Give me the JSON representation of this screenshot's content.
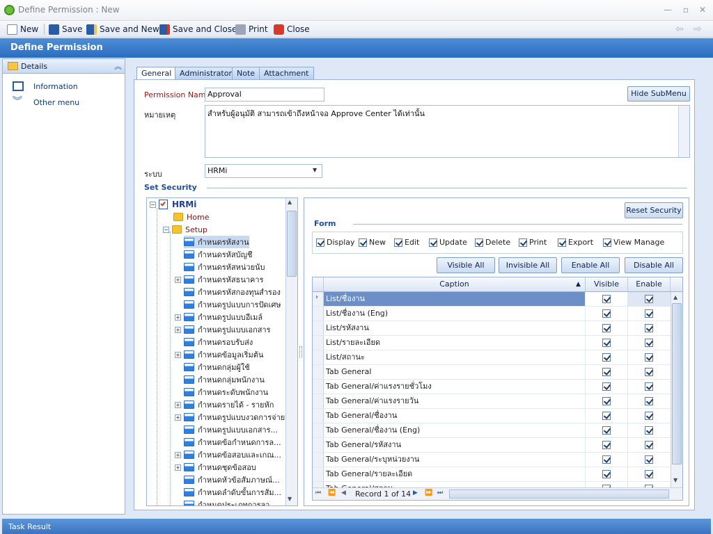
{
  "window": {
    "title": "Define Permission : New"
  },
  "toolbar": {
    "new": "New",
    "save": "Save",
    "save_and_new": "Save and New",
    "save_and_close": "Save and Close",
    "print": "Print",
    "close": "Close"
  },
  "header": {
    "title": "Define Permission"
  },
  "sidebar": {
    "details": "Details",
    "items": [
      {
        "label": "Information",
        "icon": "info-icon"
      },
      {
        "label": "Other menu",
        "icon": "double-chevron-down-icon"
      }
    ]
  },
  "tabs": [
    "General",
    "Administrator",
    "Note",
    "Attachment"
  ],
  "form": {
    "permission_name_label": "Permission Name",
    "permission_name_value": "Approval",
    "note_label": "หมายเหตุ",
    "note_value": "สำหรับผู้อนุมัติ  สามารถเข้าถึงหน้าจอ Approve Center ได้เท่านั้น",
    "system_label": "ระบบ",
    "system_value": "HRMi",
    "hide_submenu": "Hide SubMenu",
    "set_security": "Set Security"
  },
  "tree": {
    "root": "HRMi",
    "home": "Home",
    "setup": "Setup",
    "items": [
      {
        "label": "กำหนดรหัสงาน",
        "expand": false,
        "selected": true
      },
      {
        "label": "กำหนดรหัสบัญชี",
        "expand": false
      },
      {
        "label": "กำหนดรหัสหน่วยนับ",
        "expand": false
      },
      {
        "label": "กำหนดรหัสธนาคาร",
        "expand": true
      },
      {
        "label": "กำหนดรหัสกองทุนสำรอง",
        "expand": false
      },
      {
        "label": "กำหนดรูปแบบการปัดเศษ",
        "expand": false
      },
      {
        "label": "กำหนดรูปแบบอีเมล์",
        "expand": true
      },
      {
        "label": "กำหนดรูปแบบเอกสาร",
        "expand": true
      },
      {
        "label": "กำหนดรอบรับส่ง",
        "expand": false
      },
      {
        "label": "กำหนดข้อมูลเริ่มต้น",
        "expand": true
      },
      {
        "label": "กำหนดกลุ่มผู้ใช้",
        "expand": false
      },
      {
        "label": "กำหนดกลุ่มพนักงาน",
        "expand": false
      },
      {
        "label": "กำหนดระดับพนักงาน",
        "expand": false
      },
      {
        "label": "กำหนดรายได้ - รายหัก",
        "expand": true
      },
      {
        "label": "กำหนดรูปแบบงวดการจ่าย",
        "expand": true
      },
      {
        "label": "กำหนดรูปแบบเอกสาร...",
        "expand": false
      },
      {
        "label": "กำหนดข้อกำหนดการล...",
        "expand": false
      },
      {
        "label": "กำหนดข้อสอบและเกณ...",
        "expand": true
      },
      {
        "label": "กำหนดชุดข้อสอบ",
        "expand": true
      },
      {
        "label": "กำหนดหัวข้อสัมภาษณ์...",
        "expand": false
      },
      {
        "label": "กำหนดลำดับขั้นการสัม...",
        "expand": false
      },
      {
        "label": "กำหนดประเภทการลา",
        "expand": false
      }
    ]
  },
  "security": {
    "reset": "Reset Security",
    "form_label": "Form",
    "permissions": [
      "Display",
      "New",
      "Edit",
      "Update",
      "Delete",
      "Print",
      "Export",
      "View Manage"
    ],
    "visible_all": "Visible All",
    "invisible_all": "Invisible All",
    "enable_all": "Enable All",
    "disable_all": "Disable All"
  },
  "grid": {
    "headers": {
      "caption": "Caption",
      "visible": "Visible",
      "enable": "Enable"
    },
    "rows": [
      "List/ชื่องาน",
      "List/ชื่องาน (Eng)",
      "List/รหัสงาน",
      "List/รายละเอียด",
      "List/สถานะ",
      "Tab General",
      "Tab General/ค่าแรงรายชั่วโมง",
      "Tab General/ค่าแรงรายวัน",
      "Tab General/ชื่องาน",
      "Tab General/ชื่องาน (Eng)",
      "Tab General/รหัสงาน",
      "Tab General/ระบุหน่วยงาน",
      "Tab General/รายละเอียด",
      "Tab General/สถานะ"
    ],
    "record_text": "Record 1 of 14"
  },
  "statusbar": {
    "text": "Task Result"
  }
}
